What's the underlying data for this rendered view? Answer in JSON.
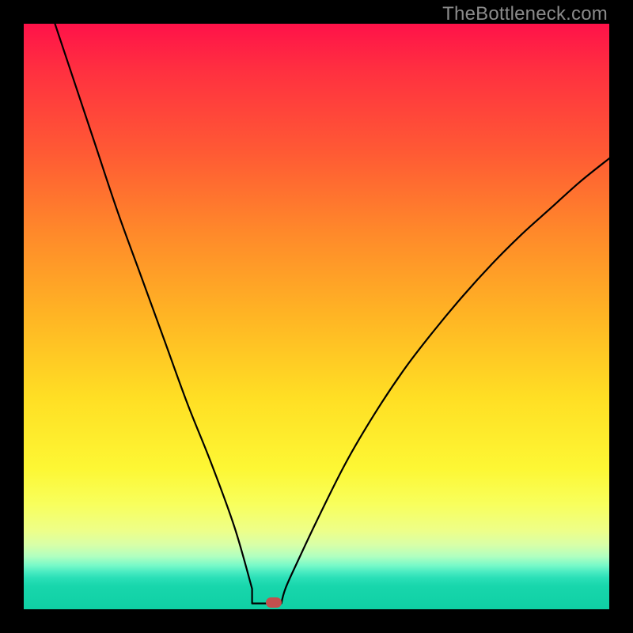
{
  "attribution": "TheBottleneck.com",
  "colors": {
    "frame": "#000000",
    "curve": "#000000",
    "marker": "#c2504e",
    "gradient_stops": [
      "#ff1249",
      "#ff3040",
      "#ff5a34",
      "#ff8a2a",
      "#ffb524",
      "#ffdf24",
      "#fdf734",
      "#f8ff5c",
      "#eeff88",
      "#d8ffa8",
      "#b0ffc0",
      "#78f9c8",
      "#4becc2",
      "#2be0b8",
      "#18d6ac",
      "#0fd0a4"
    ]
  },
  "chart_data": {
    "type": "line",
    "title": "",
    "xlabel": "",
    "ylabel": "",
    "xlim": [
      0,
      100
    ],
    "ylim": [
      0,
      100
    ],
    "notch_x": 42,
    "flat_start_x": 39,
    "flat_end_x": 44,
    "marker": {
      "x": 42.7,
      "y": 1.2
    },
    "series": [
      {
        "name": "bottleneck-curve",
        "x": [
          0,
          4,
          8,
          12,
          16,
          20,
          24,
          28,
          32,
          36,
          39,
          40.5,
          42,
          43.2,
          44,
          46,
          50,
          55,
          60,
          65,
          70,
          75,
          80,
          85,
          90,
          95,
          100
        ],
        "y": [
          116,
          104,
          92,
          80,
          68,
          57,
          46,
          35,
          25,
          14,
          3.5,
          1.2,
          1.0,
          1.2,
          2.2,
          6.5,
          15,
          25,
          33.5,
          41,
          47.5,
          53.5,
          59,
          64,
          68.5,
          73,
          77
        ]
      }
    ]
  }
}
